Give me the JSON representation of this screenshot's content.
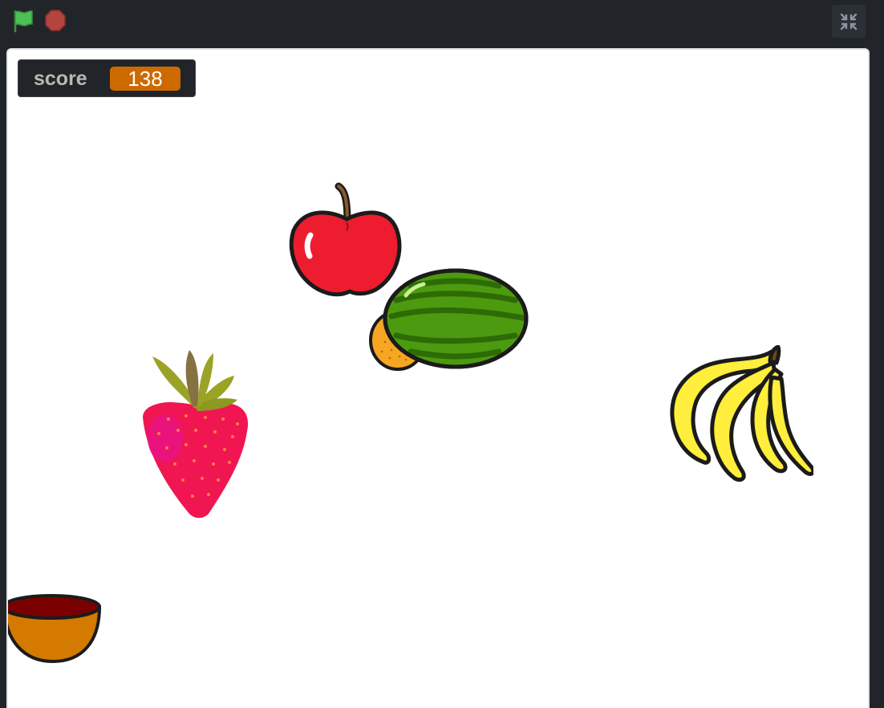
{
  "toolbar": {
    "green_flag_icon": "green-flag-icon",
    "stop_icon": "stop-sign-icon",
    "fullscreen_icon": "exit-fullscreen-icon"
  },
  "monitor": {
    "label": "score",
    "value": "138"
  },
  "sprites": [
    "apple",
    "orange",
    "watermelon",
    "strawberry",
    "bananas",
    "bowl"
  ],
  "colors": {
    "monitor_value_bg": "#cc6a00",
    "flag_green": "#4cbf56",
    "stop_red": "#b5433e"
  }
}
